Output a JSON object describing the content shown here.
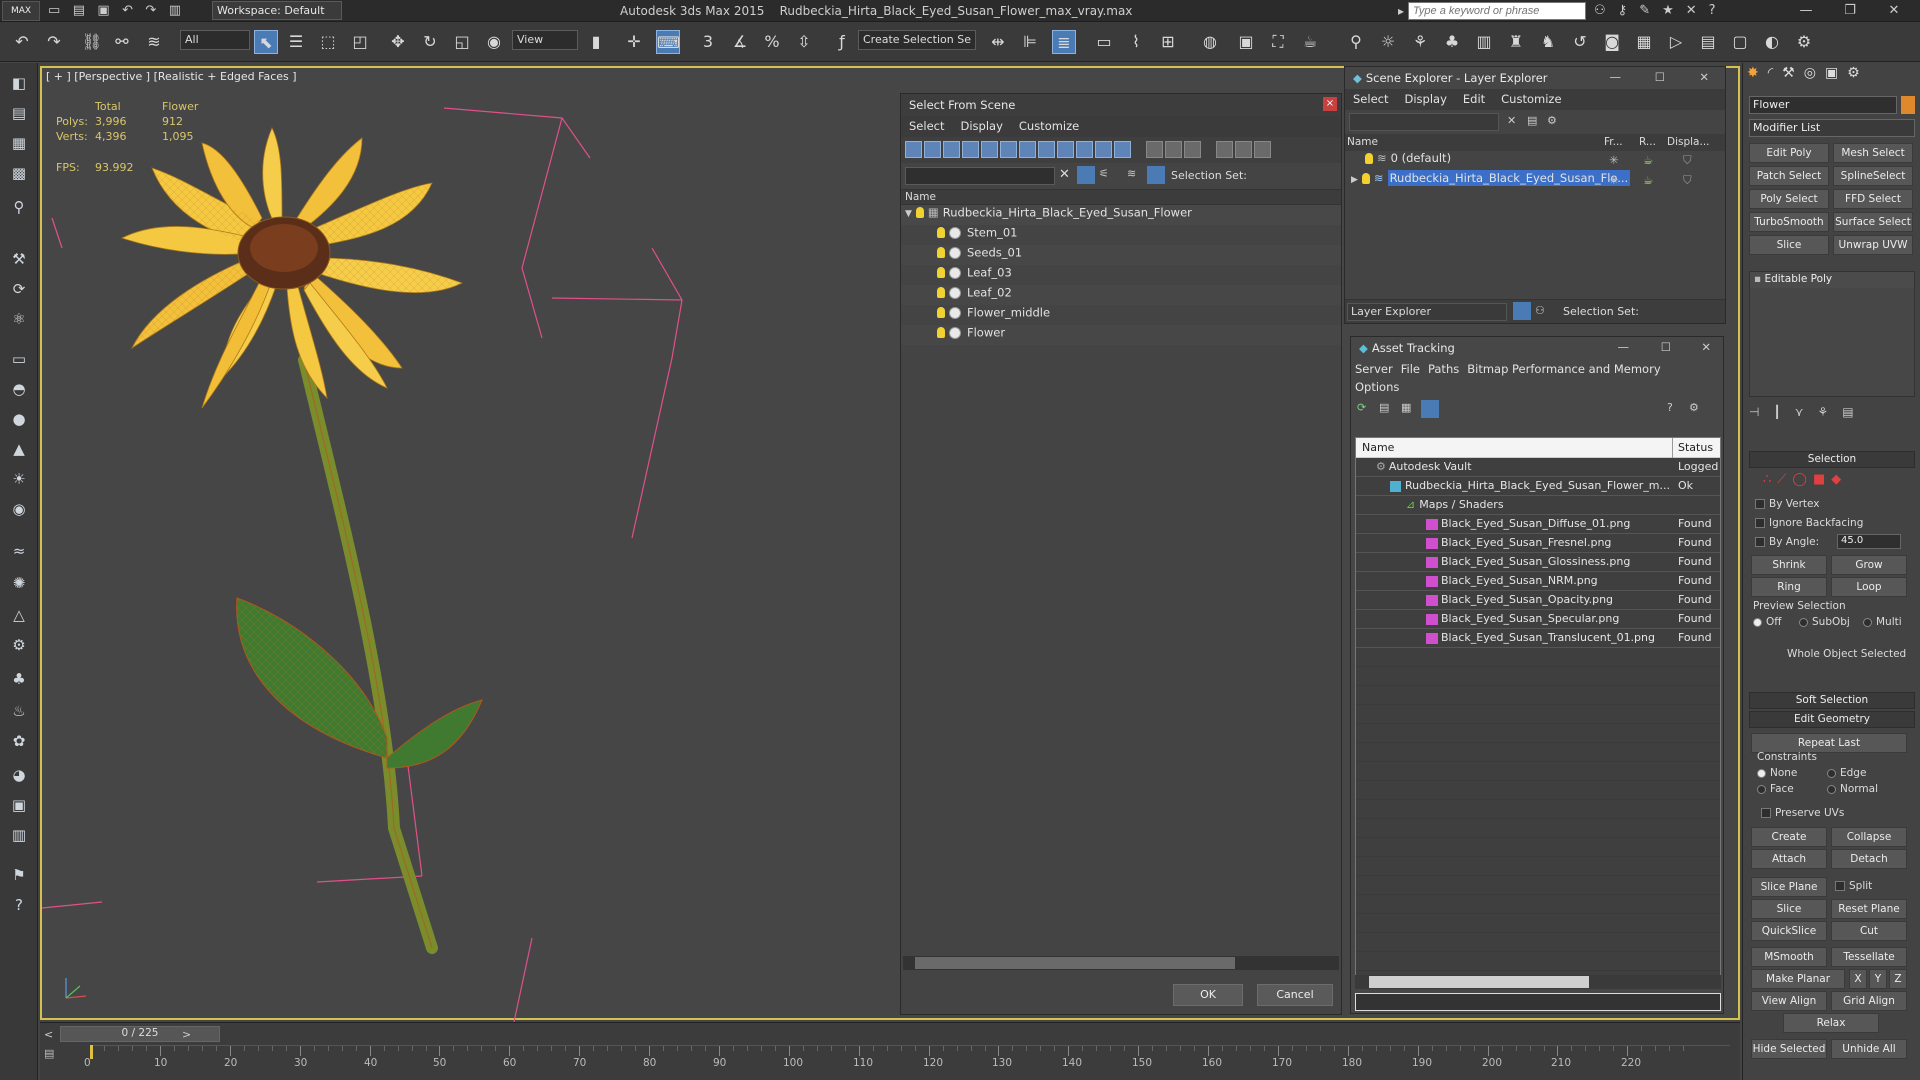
{
  "titlebar": {
    "app": "Autodesk 3ds Max  2015",
    "file": "Rudbeckia_Hirta_Black_Eyed_Susan_Flower_max_vray.max",
    "logo": "MAX",
    "workspace": "Workspace: Default",
    "search_placeholder": "Type a keyword or phrase"
  },
  "toolbar": {
    "filter": "All",
    "view": "View",
    "selection_set": "Create Selection Se"
  },
  "viewport": {
    "label": "[ + ] [Perspective ] [Realistic + Edged Faces ]",
    "stats": {
      "col_total": "Total",
      "col_flower": "Flower",
      "polys_label": "Polys:",
      "polys_total": "3,996",
      "polys_flower": "912",
      "verts_label": "Verts:",
      "verts_total": "4,396",
      "verts_flower": "1,095",
      "fps_label": "FPS:",
      "fps_value": "93.992"
    }
  },
  "select_from_scene": {
    "title": "Select From Scene",
    "menu": [
      "Select",
      "Display",
      "Customize"
    ],
    "selection_set_label": "Selection Set:",
    "name_header": "Name",
    "root": "Rudbeckia_Hirta_Black_Eyed_Susan_Flower",
    "children": [
      "Stem_01",
      "Seeds_01",
      "Leaf_03",
      "Leaf_02",
      "Flower_middle",
      "Flower"
    ],
    "ok": "OK",
    "cancel": "Cancel"
  },
  "scene_explorer": {
    "title": "Scene Explorer - Layer Explorer",
    "menu": [
      "Select",
      "Display",
      "Edit",
      "Customize"
    ],
    "columns": [
      "Name",
      "Fr...",
      "R...",
      "Displa..."
    ],
    "rows": [
      "0 (default)",
      "Rudbeckia_Hirta_Black_Eyed_Susan_Flo..."
    ],
    "footer_explorer": "Layer Explorer",
    "footer_selection": "Selection Set:"
  },
  "asset_tracking": {
    "title": "Asset Tracking",
    "menu": [
      "Server",
      "File",
      "Paths",
      "Bitmap Performance and Memory"
    ],
    "menu2": "Options",
    "col_name": "Name",
    "col_status": "Status",
    "rows": [
      {
        "name": "Autodesk Vault",
        "status": "Logged"
      },
      {
        "name": "Rudbeckia_Hirta_Black_Eyed_Susan_Flower_m...",
        "status": "Ok"
      },
      {
        "name": "Maps / Shaders",
        "status": ""
      },
      {
        "name": "Black_Eyed_Susan_Diffuse_01.png",
        "status": "Found"
      },
      {
        "name": "Black_Eyed_Susan_Fresnel.png",
        "status": "Found"
      },
      {
        "name": "Black_Eyed_Susan_Glossiness.png",
        "status": "Found"
      },
      {
        "name": "Black_Eyed_Susan_NRM.png",
        "status": "Found"
      },
      {
        "name": "Black_Eyed_Susan_Opacity.png",
        "status": "Found"
      },
      {
        "name": "Black_Eyed_Susan_Specular.png",
        "status": "Found"
      },
      {
        "name": "Black_Eyed_Susan_Translucent_01.png",
        "status": "Found"
      }
    ]
  },
  "command_panel": {
    "object_name": "Flower",
    "modifier_list": "Modifier List",
    "mod_buttons": [
      "Edit Poly",
      "Mesh Select",
      "Patch Select",
      "SplineSelect",
      "Poly Select",
      "FFD Select",
      "TurboSmooth",
      "Surface Select",
      "Slice",
      "Unwrap UVW"
    ],
    "stack_item": "Editable Poly",
    "selection_title": "Selection",
    "by_vertex": "By Vertex",
    "ignore_backfacing": "Ignore Backfacing",
    "by_angle": "By Angle:",
    "angle_value": "45.0",
    "shrink": "Shrink",
    "grow": "Grow",
    "ring": "Ring",
    "loop": "Loop",
    "preview_selection": "Preview Selection",
    "preview_off": "Off",
    "preview_subobj": "SubObj",
    "preview_multi": "Multi",
    "whole_object": "Whole Object Selected",
    "soft_selection": "Soft Selection",
    "edit_geometry": "Edit Geometry",
    "repeat_last": "Repeat Last",
    "constraints": "Constraints",
    "c_none": "None",
    "c_edge": "Edge",
    "c_face": "Face",
    "c_normal": "Normal",
    "preserve_uvs": "Preserve UVs",
    "create": "Create",
    "collapse": "Collapse",
    "attach": "Attach",
    "detach": "Detach",
    "slice_plane": "Slice Plane",
    "split": "Split",
    "slice": "Slice",
    "reset_plane": "Reset Plane",
    "quickslice": "QuickSlice",
    "cut": "Cut",
    "msmooth": "MSmooth",
    "tessellate": "Tessellate",
    "make_planar": "Make Planar",
    "x": "X",
    "y": "Y",
    "z": "Z",
    "view_align": "View Align",
    "grid_align": "Grid Align",
    "relax": "Relax",
    "hide_selected": "Hide Selected",
    "unhide_all": "Unhide All"
  },
  "timeline": {
    "frame": "0 / 225",
    "ticks": [
      "0",
      "10",
      "20",
      "30",
      "40",
      "50",
      "60",
      "70",
      "80",
      "90",
      "100",
      "110",
      "120",
      "130",
      "140",
      "150",
      "160",
      "170",
      "180",
      "190",
      "200",
      "210",
      "220"
    ]
  },
  "colors": {
    "viewport_border": "#d4c24e",
    "selection_highlight": "#3b6fc8",
    "petal": "#f5c842",
    "stem": "#6a7a25",
    "leaf": "#3f7a30"
  }
}
